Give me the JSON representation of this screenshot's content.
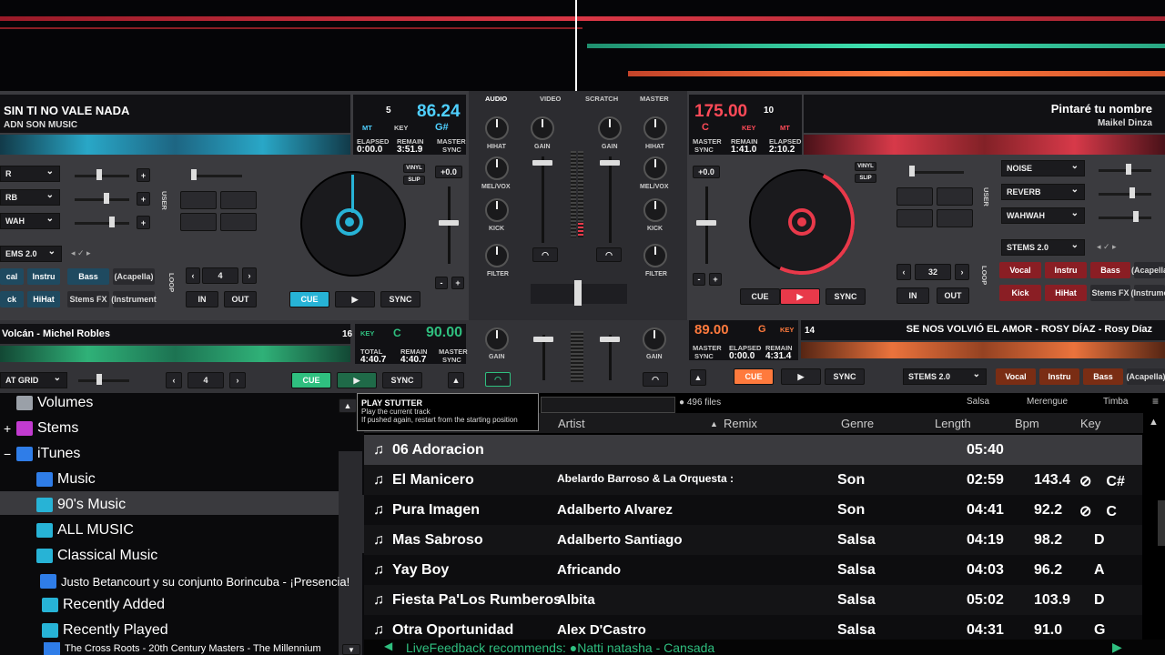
{
  "deck_left": {
    "title": "SIN TI NO VALE NADA",
    "artist": "ADN SON MUSIC",
    "deck_num": "5",
    "bpm": "86.24",
    "key_tag": "MT",
    "key_label": "KEY",
    "key": "G#",
    "elapsed_label": "ELAPSED",
    "elapsed": "0:00.0",
    "remain_label": "REMAIN",
    "remain": "3:51.9",
    "master_label": "MASTER",
    "sync_label": "SYNC",
    "fx": [
      "R",
      "RB",
      "WAH"
    ],
    "pitch": "+0.0",
    "vinyl": "VINYL",
    "slip": "SLIP",
    "user": "USER",
    "loop": "LOOP",
    "stems_dd": "EMS 2.0",
    "loop_val": "4",
    "in_label": "IN",
    "out_label": "OUT",
    "cue": "CUE",
    "sync": "SYNC",
    "stems": [
      "cal",
      "Instru",
      "Bass",
      "(Acapella)",
      "ck",
      "HiHat",
      "Stems FX",
      "(Instrument"
    ]
  },
  "deck_right": {
    "title": "Pintaré tu nombre",
    "artist": "Maikel Dinza",
    "deck_num": "10",
    "bpm": "175.00",
    "key_label": "KEY",
    "key": "C",
    "key_tag": "MT",
    "master_label": "MASTER",
    "sync_label": "SYNC",
    "elapsed_label": "ELAPSED",
    "elapsed": "2:10.2",
    "remain_label": "REMAIN",
    "remain": "1:41.0",
    "fx": [
      "NOISE",
      "REVERB",
      "WAHWAH"
    ],
    "pitch": "+0.0",
    "vinyl": "VINYL",
    "slip": "SLIP",
    "user": "USER",
    "loop": "LOOP",
    "stems_dd": "STEMS 2.0",
    "loop_val": "32",
    "in_label": "IN",
    "out_label": "OUT",
    "cue": "CUE",
    "sync": "SYNC",
    "stems": [
      "Vocal",
      "Instru",
      "Bass",
      "(Acapella",
      "Kick",
      "HiHat",
      "Stems FX",
      "(Instrume"
    ]
  },
  "mixer": {
    "tabs": [
      "AUDIO",
      "VIDEO",
      "SCRATCH",
      "MASTER"
    ],
    "knobs_left": [
      "HIHAT",
      "MEL/VOX",
      "KICK",
      "FILTER"
    ],
    "knobs_right": [
      "HIHAT",
      "MEL/VOX",
      "KICK",
      "FILTER"
    ],
    "gain": "GAIN"
  },
  "deck_bl": {
    "title": "Volcán - Michel Robles",
    "deck_num": "16",
    "key_label": "KEY",
    "key": "C",
    "bpm": "90.00",
    "total_label": "TOTAL",
    "total": "4:40.7",
    "remain_label": "REMAIN",
    "remain": "4:40.7",
    "master_label": "MASTER",
    "sync_label": "SYNC",
    "grid_dd": "AT GRID",
    "loop_val": "4",
    "cue": "CUE",
    "sync": "SYNC",
    "gain": "GAIN"
  },
  "deck_br": {
    "bpm": "89.00",
    "key": "G",
    "key_label": "KEY",
    "deck_num": "14",
    "title": "SE NOS VOLVIÓ EL AMOR - ROSY DÍAZ - Rosy Díaz",
    "master_label": "MASTER",
    "sync_label": "SYNC",
    "elapsed_label": "ELAPSED",
    "elapsed": "0:00.0",
    "remain_label": "REMAIN",
    "remain": "4:31.4",
    "cue": "CUE",
    "sync": "SYNC",
    "stems_dd": "STEMS 2.0",
    "stems": [
      "Vocal",
      "Instru",
      "Bass",
      "(Acapella)"
    ],
    "gain": "GAIN"
  },
  "tooltip": {
    "title": "PLAY STUTTER",
    "line1": "Play the current track",
    "line2": "If pushed again, restart from the starting position"
  },
  "browser": {
    "file_count": "496 files",
    "filters": [
      "Salsa",
      "Merengue",
      "Timba"
    ],
    "columns": [
      "Artist",
      "Remix",
      "Genre",
      "Length",
      "Bpm",
      "Key"
    ],
    "tree": [
      {
        "label": "Volumes",
        "color": "#9aa0a8"
      },
      {
        "label": "Stems",
        "color": "#c23bd0"
      },
      {
        "label": "iTunes",
        "color": "#2f7de8"
      },
      {
        "label": "Music",
        "color": "#2f7de8"
      },
      {
        "label": "90's Music",
        "color": "#27b3d6"
      },
      {
        "label": "ALL MUSIC",
        "color": "#27b3d6"
      },
      {
        "label": "Classical Music",
        "color": "#27b3d6"
      },
      {
        "label": "Justo Betancourt y su conjunto Borincuba - ¡Presencia!",
        "color": "#2f7de8"
      },
      {
        "label": "Recently Added",
        "color": "#27b3d6"
      },
      {
        "label": "Recently Played",
        "color": "#27b3d6"
      },
      {
        "label": "The Cross Roots - 20th Century Masters - The Millennium",
        "color": "#2f7de8"
      }
    ],
    "rows": [
      {
        "title": "06 Adoracion",
        "artist": "",
        "genre": "",
        "length": "05:40",
        "bpm": "",
        "key": ""
      },
      {
        "title": "El Manicero",
        "artist": "Abelardo Barroso & La Orquesta :",
        "genre": "Son",
        "length": "02:59",
        "bpm": "143.4",
        "key": "C#"
      },
      {
        "title": "Pura Imagen",
        "artist": "Adalberto Alvarez",
        "genre": "Son",
        "length": "04:41",
        "bpm": "92.2",
        "key": "C"
      },
      {
        "title": "Mas Sabroso",
        "artist": "Adalberto Santiago",
        "genre": "Salsa",
        "length": "04:19",
        "bpm": "98.2",
        "key": "D"
      },
      {
        "title": "Yay Boy",
        "artist": "Africando",
        "genre": "Salsa",
        "length": "04:03",
        "bpm": "96.2",
        "key": "A"
      },
      {
        "title": "Fiesta Pa'Los Rumberos",
        "artist": "Albita",
        "genre": "Salsa",
        "length": "05:02",
        "bpm": "103.9",
        "key": "D"
      },
      {
        "title": "Otra Oportunidad",
        "artist": "Alex D'Castro",
        "genre": "Salsa",
        "length": "04:31",
        "bpm": "91.0",
        "key": "G"
      }
    ],
    "feedback": "LiveFeedback recommends: ●Natti natasha - Cansada",
    "side_tab": "folders"
  },
  "colors": {
    "blue": "#27b3d6",
    "red": "#e8394a",
    "green": "#2fbf7f",
    "orange": "#ff7a3d"
  }
}
